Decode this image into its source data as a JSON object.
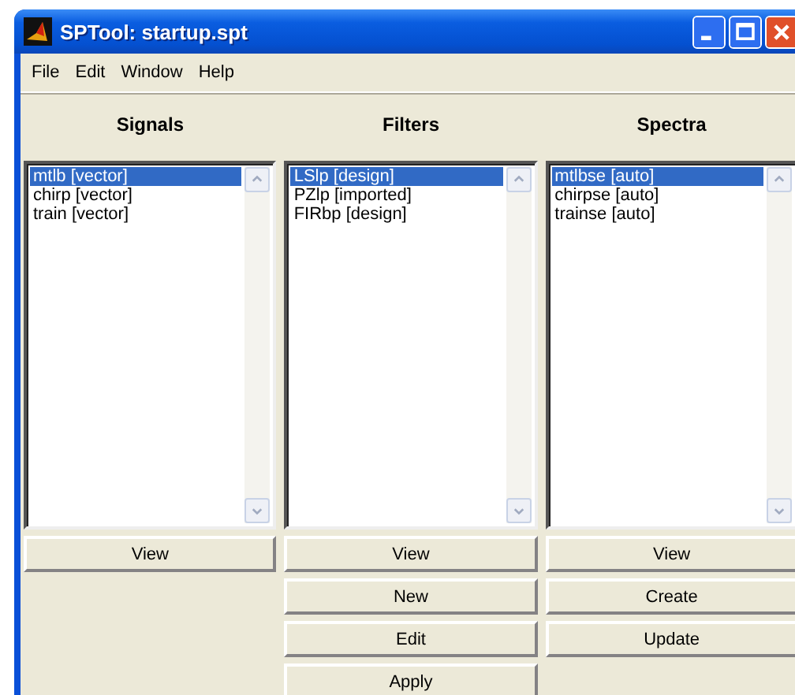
{
  "window": {
    "title": "SPTool: startup.spt"
  },
  "menu": [
    "File",
    "Edit",
    "Window",
    "Help"
  ],
  "panels": [
    {
      "heading": "Signals",
      "items": [
        {
          "label": "mtlb [vector]",
          "selected": true
        },
        {
          "label": "chirp [vector]",
          "selected": false
        },
        {
          "label": "train [vector]",
          "selected": false
        }
      ],
      "buttons": [
        "View"
      ]
    },
    {
      "heading": "Filters",
      "items": [
        {
          "label": "LSlp [design]",
          "selected": true
        },
        {
          "label": "PZlp [imported]",
          "selected": false
        },
        {
          "label": "FIRbp [design]",
          "selected": false
        }
      ],
      "buttons": [
        "View",
        "New",
        "Edit",
        "Apply"
      ]
    },
    {
      "heading": "Spectra",
      "items": [
        {
          "label": "mtlbse [auto]",
          "selected": true
        },
        {
          "label": "chirpse [auto]",
          "selected": false
        },
        {
          "label": "trainse [auto]",
          "selected": false
        }
      ],
      "buttons": [
        "View",
        "Create",
        "Update"
      ]
    }
  ]
}
